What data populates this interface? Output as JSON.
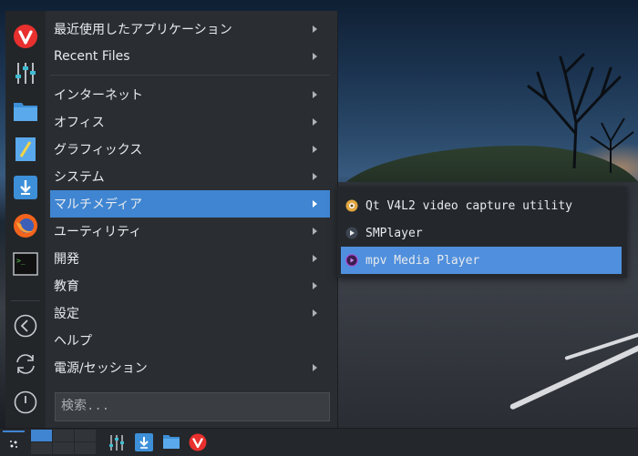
{
  "menu": {
    "items": [
      {
        "label": "最近使用したアプリケーション",
        "has_submenu": true
      },
      {
        "label": "Recent Files",
        "has_submenu": true
      },
      {
        "label": "インターネット",
        "has_submenu": true
      },
      {
        "label": "オフィス",
        "has_submenu": true
      },
      {
        "label": "グラフィックス",
        "has_submenu": true
      },
      {
        "label": "システム",
        "has_submenu": true
      },
      {
        "label": "マルチメディア",
        "has_submenu": true,
        "active": true
      },
      {
        "label": "ユーティリティ",
        "has_submenu": true
      },
      {
        "label": "開発",
        "has_submenu": true
      },
      {
        "label": "教育",
        "has_submenu": true
      },
      {
        "label": "設定",
        "has_submenu": true
      },
      {
        "label": "ヘルプ",
        "has_submenu": false
      },
      {
        "label": "電源/セッション",
        "has_submenu": true
      }
    ],
    "search_placeholder": "検索..."
  },
  "submenu": {
    "items": [
      {
        "label": "Qt V4L2 video capture utility",
        "icon": "webcam-icon"
      },
      {
        "label": "SMPlayer",
        "icon": "smplayer-icon"
      },
      {
        "label": "mpv Media Player",
        "icon": "mpv-icon",
        "active": true
      }
    ]
  },
  "strip": {
    "icons": [
      "vivaldi-icon",
      "mixer-icon",
      "folder-icon",
      "text-editor-icon",
      "download-icon",
      "firefox-icon",
      "terminal-icon",
      "back-icon",
      "refresh-icon",
      "power-icon"
    ]
  },
  "taskbar": {
    "launchers": [
      "mixer-icon",
      "download-icon",
      "folder-icon",
      "vivaldi-icon"
    ]
  },
  "colors": {
    "accent": "#3f85d2",
    "menu_bg": "#2a2e32",
    "vivaldi_red": "#e8302e"
  }
}
